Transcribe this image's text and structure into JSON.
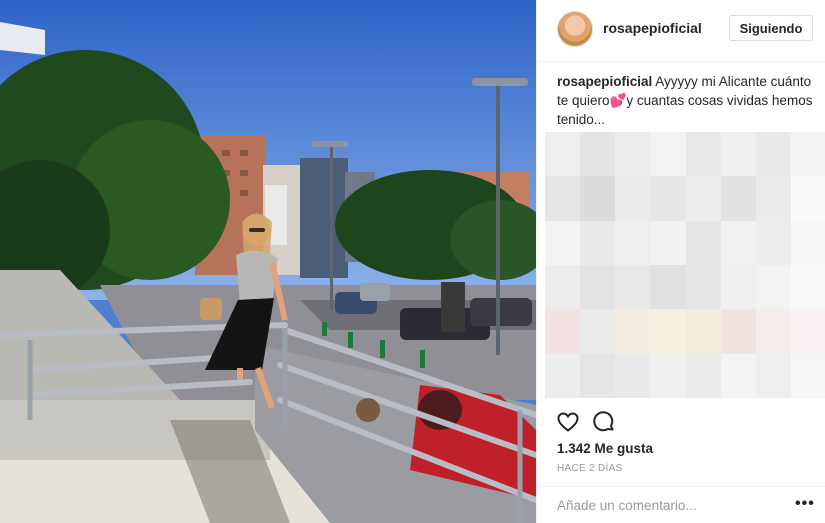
{
  "post": {
    "username": "rosapepioficial",
    "follow_label": "Siguiendo",
    "caption_user": "rosapepioficial",
    "caption_text_1": " Ayyyyy mi Alicante cuánto te quiero",
    "caption_emoji": "💕",
    "caption_text_2": "y cuantas cosas vividas hemos tenido...",
    "likes_label": "1.342 Me gusta",
    "time_label": "HACE 2 DÍAS",
    "comment_placeholder": "Añade un comentario...",
    "more_label": "•••"
  },
  "icons": {
    "like": "heart-outline-icon",
    "comment": "comment-bubble-icon",
    "options": "more-options-icon"
  },
  "colors": {
    "text": "#262626",
    "secondary_text": "#999999",
    "border": "#efefef",
    "sky": "#3b6fd0"
  }
}
